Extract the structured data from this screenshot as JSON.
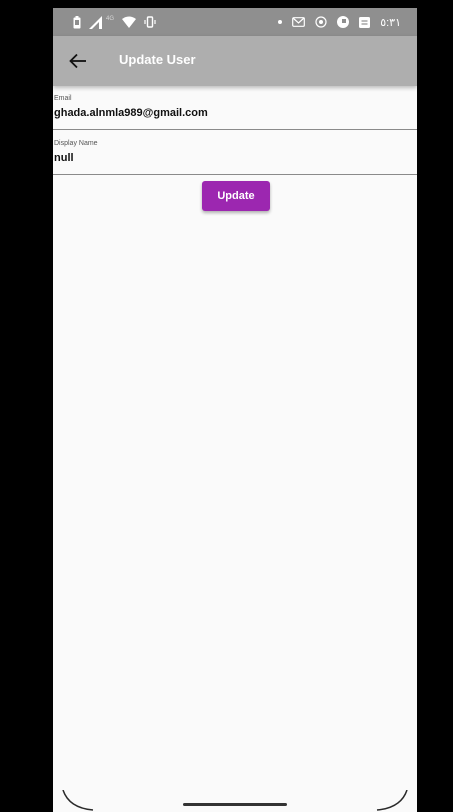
{
  "status_bar": {
    "time": "٥:٣١",
    "network_label": "4G",
    "icons": [
      "battery-icon",
      "signal-icon",
      "wifi-icon",
      "vibrate-icon",
      "dot-icon",
      "gmail-icon",
      "location-icon",
      "app-icon",
      "message-icon"
    ]
  },
  "app_bar": {
    "title": "Update User",
    "back_icon": "arrow-back-icon"
  },
  "form": {
    "email": {
      "label": "Email",
      "value": "ghada.alnmla989@gmail.com"
    },
    "display_name": {
      "label": "Display Name",
      "value": "null"
    }
  },
  "actions": {
    "update_label": "Update"
  },
  "colors": {
    "accent": "#9c27b0",
    "app_bar": "#aeaeae",
    "status_bar": "#8f8f8f",
    "background": "#fafafa"
  }
}
